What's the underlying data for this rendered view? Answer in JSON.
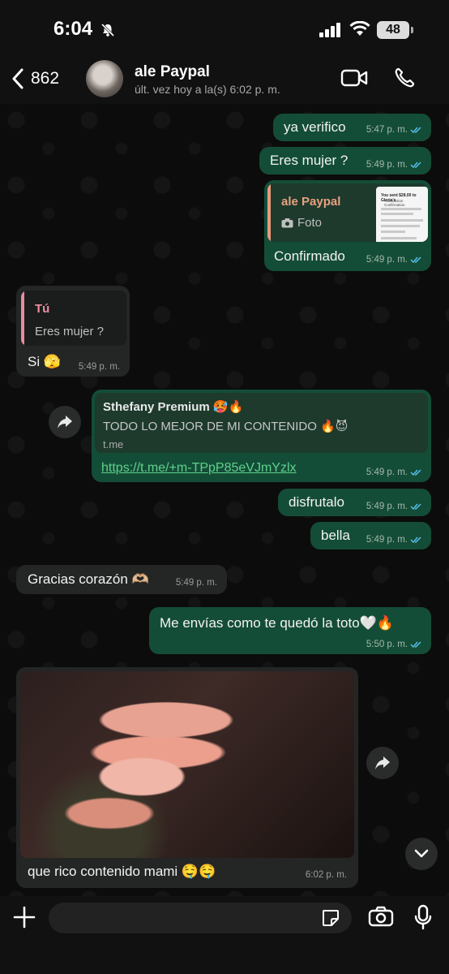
{
  "status": {
    "time": "6:04",
    "battery": "48"
  },
  "header": {
    "back_count": "862",
    "contact_name": "ale Paypal",
    "last_seen": "últ. vez hoy a la(s) 6:02 p. m."
  },
  "messages": [
    {
      "text": "ya verifico",
      "time": "5:47 p. m."
    },
    {
      "text": "Eres mujer ?",
      "time": "5:49 p. m."
    },
    {
      "quote_name": "ale Paypal",
      "quote_text": "Foto",
      "text": "Confirmado",
      "time": "5:49 p. m."
    },
    {
      "quote_name": "Tú",
      "quote_text": "Eres mujer ?",
      "text": "Si 🫣",
      "time": "5:49 p. m."
    },
    {
      "preview_title": "Sthefany Premium 🥵🔥",
      "preview_desc": "TODO LO MEJOR DE MI CONTENIDO 🔥😈",
      "preview_domain": "t.me",
      "link": "https://t.me/+m-TPpP85eVJmYzlx",
      "time": "5:49 p. m."
    },
    {
      "text": "disfrutalo",
      "time": "5:49 p. m."
    },
    {
      "text": "bella",
      "time": "5:49 p. m."
    },
    {
      "text": "Gracias corazón 🫶🏼",
      "time": "5:49 p. m."
    },
    {
      "text": "Me envías como te quedó la toto🤍🔥",
      "time": "5:50 p. m."
    },
    {
      "text": "que rico contenido mami 🤤🤤",
      "time": "6:02 p. m."
    }
  ],
  "receipt_thumb": {
    "title": "You sent $28.00 to Gloria's",
    "subtitle": "Transaction Confirmation"
  },
  "colors": {
    "outgoing": "#144d37",
    "incoming": "#242626",
    "link": "#5fd18c",
    "ticks": "#53bdeb"
  }
}
